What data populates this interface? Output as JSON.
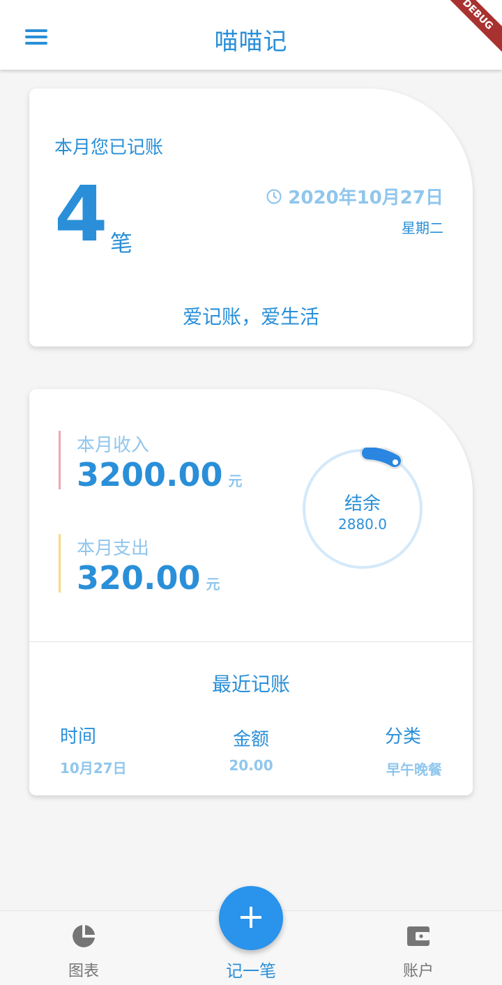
{
  "appbar": {
    "title": "喵喵记",
    "debug_ribbon": "DEBUG"
  },
  "summary_card": {
    "title": "本月您已记账",
    "count": "4",
    "count_unit": "笔",
    "date": "2020年10月27日",
    "weekday": "星期二",
    "slogan": "爱记账，爱生活"
  },
  "stats_card": {
    "income": {
      "label": "本月收入",
      "value": "3200.00",
      "unit": "元",
      "accent": "#f0a4b8"
    },
    "expense": {
      "label": "本月支出",
      "value": "320.00",
      "unit": "元",
      "accent": "#f4dc7c"
    },
    "balance": {
      "label": "结余",
      "value": "2880.0"
    },
    "recent": {
      "title": "最近记账",
      "columns": [
        {
          "header": "时间",
          "value": "10月27日"
        },
        {
          "header": "金额",
          "value": "20.00"
        },
        {
          "header": "分类",
          "value": "早午晚餐"
        }
      ]
    }
  },
  "bottom_nav": {
    "items": [
      {
        "label": "图表",
        "icon": "pie-chart-icon"
      },
      {
        "label": "记一笔",
        "icon": "plus-icon"
      },
      {
        "label": "账户",
        "icon": "wallet-icon"
      }
    ],
    "fab_symbol": "+"
  },
  "colors": {
    "primary": "#2a8fd8",
    "light": "#90c6ec",
    "fab": "#2a93ec"
  }
}
